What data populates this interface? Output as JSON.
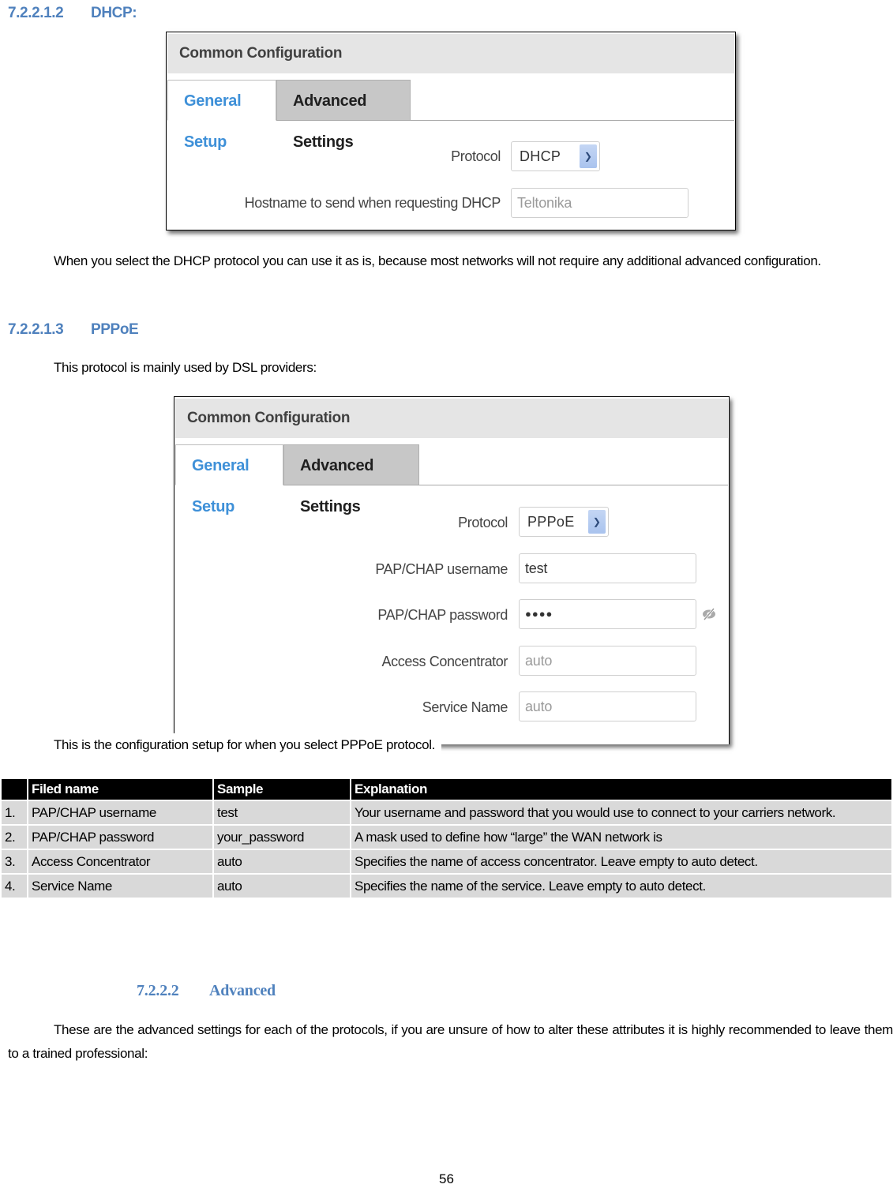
{
  "sections": {
    "dhcp": {
      "number": "7.2.2.1.2",
      "title": "DHCP:"
    },
    "pppoe": {
      "number": "7.2.2.1.3",
      "title": "PPPoE"
    },
    "advanced": {
      "number": "7.2.2.2",
      "title": "Advanced"
    }
  },
  "paragraphs": {
    "dhcp_note": "When you select the DHCP protocol you can use it as is, because most networks will not require any additional advanced configuration.",
    "pppoe_intro": "This protocol is mainly used by DSL providers:",
    "pppoe_caption": "This is the configuration setup for when you select PPPoE protocol.",
    "advanced_intro": "These are the advanced settings for each of the protocols, if you are unsure of how to alter these attributes it is highly recommended to leave them to a trained professional:"
  },
  "dhcp_screenshot": {
    "panel_title": "Common Configuration",
    "tabs": [
      {
        "label": "General Setup",
        "active": true
      },
      {
        "label": "Advanced Settings",
        "active": false
      }
    ],
    "fields": {
      "protocol": {
        "label": "Protocol",
        "value": "DHCP"
      },
      "hostname": {
        "label": "Hostname to send when requesting DHCP",
        "placeholder": "Teltonika"
      }
    }
  },
  "pppoe_screenshot": {
    "panel_title": "Common Configuration",
    "tabs": [
      {
        "label": "General Setup",
        "active": true
      },
      {
        "label": "Advanced Settings",
        "active": false
      }
    ],
    "fields": {
      "protocol": {
        "label": "Protocol",
        "value": "PPPoE"
      },
      "username": {
        "label": "PAP/CHAP username",
        "value": "test"
      },
      "password": {
        "label": "PAP/CHAP password",
        "value": "●●●●",
        "toggle_icon": "eye-slash-icon"
      },
      "access_concentrator": {
        "label": "Access Concentrator",
        "placeholder": "auto"
      },
      "service_name": {
        "label": "Service Name",
        "placeholder": "auto"
      }
    }
  },
  "table": {
    "headers": [
      "",
      "Filed name",
      "Sample",
      "Explanation"
    ],
    "rows": [
      {
        "num": "1.",
        "field": "PAP/CHAP username",
        "sample": "test",
        "explanation": "Your username and password that you would use to connect to your carriers network."
      },
      {
        "num": "2.",
        "field": "PAP/CHAP password",
        "sample": "your_password",
        "explanation": "A mask used to define how “large” the WAN network is"
      },
      {
        "num": "3.",
        "field": "Access Concentrator",
        "sample": "auto",
        "explanation": "Specifies the name of access concentrator. Leave empty to auto detect."
      },
      {
        "num": "4.",
        "field": "Service Name",
        "sample": "auto",
        "explanation": "Specifies the name of the service. Leave empty to auto detect."
      }
    ]
  },
  "page_number": "56",
  "colors": {
    "heading": "#4f81bd",
    "tab_active": "#3e90d8",
    "table_header_bg": "#000000",
    "table_cell_bg": "#d9d9d9"
  }
}
